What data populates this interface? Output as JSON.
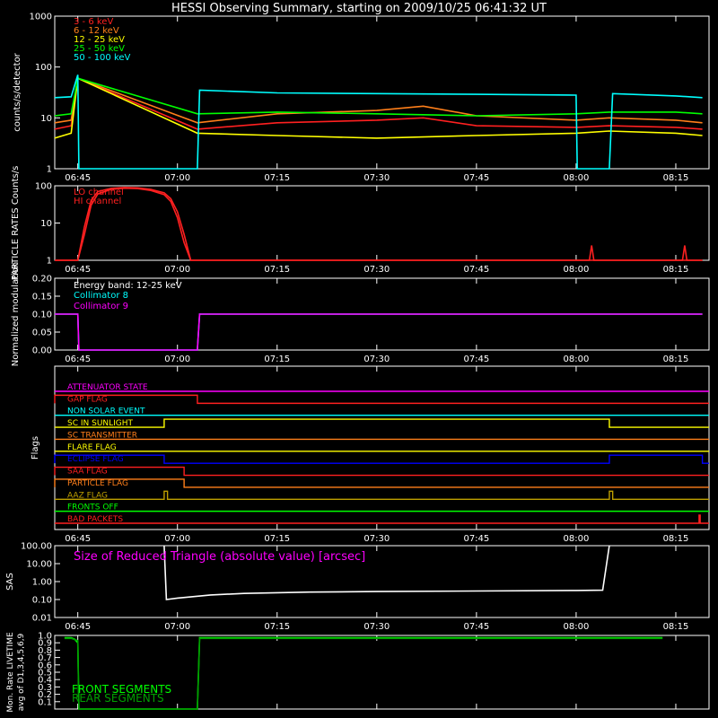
{
  "title": "HESSI Observing Summary, starting on 2009/10/25 06:41:32 UT",
  "time_ticks": [
    "06:45",
    "07:00",
    "07:15",
    "07:30",
    "07:45",
    "08:00",
    "08:15"
  ],
  "colors": {
    "background": "#000000",
    "axes": "#ffffff",
    "red": "#ff2020",
    "orange": "#ff7f1a",
    "yellow": "#ffff00",
    "green": "#00ff00",
    "cyan": "#00ffff",
    "magenta": "#ff00ff",
    "blue": "#0000ff",
    "olive": "#bfa000",
    "dark_green": "#00a000"
  },
  "chart_data": [
    {
      "type": "line",
      "panel": "count_rates",
      "ylabel": "counts/s/detector",
      "yscale": "log",
      "ylim": [
        1,
        1000
      ],
      "yticks": [
        "1",
        "10",
        "100",
        "1000"
      ],
      "legend_position": "top-left",
      "series": [
        {
          "name": "3 - 6 keV",
          "color": "#ff2020",
          "x": [
            "06:41:32",
            "06:44",
            "06:45",
            "07:03",
            "07:15",
            "07:30",
            "07:37",
            "07:45",
            "08:00",
            "08:05",
            "08:15",
            "08:19"
          ],
          "y": [
            6,
            7,
            60,
            6,
            8,
            9,
            10,
            7,
            6.5,
            7,
            6.5,
            6
          ]
        },
        {
          "name": "6 - 12 keV",
          "color": "#ff7f1a",
          "x": [
            "06:41:32",
            "06:44",
            "06:45",
            "07:03",
            "07:15",
            "07:30",
            "07:37",
            "07:45",
            "08:00",
            "08:05",
            "08:15",
            "08:19"
          ],
          "y": [
            8,
            9,
            60,
            8,
            12,
            14,
            17,
            11,
            9,
            10,
            9,
            8
          ]
        },
        {
          "name": "12 - 25 keV",
          "color": "#ffff00",
          "x": [
            "06:41:32",
            "06:44",
            "06:45",
            "07:03",
            "07:15",
            "07:30",
            "07:45",
            "08:00",
            "08:05",
            "08:15",
            "08:19"
          ],
          "y": [
            4,
            5,
            60,
            5,
            4.5,
            4,
            4.5,
            5,
            5.5,
            5,
            4.5
          ]
        },
        {
          "name": "25 - 50 keV",
          "color": "#00ff00",
          "x": [
            "06:41:32",
            "06:44",
            "06:45",
            "07:03",
            "07:15",
            "07:30",
            "07:45",
            "08:00",
            "08:05",
            "08:15",
            "08:19"
          ],
          "y": [
            11,
            12,
            60,
            12,
            13,
            12,
            11,
            12,
            13,
            13,
            12
          ]
        },
        {
          "name": "50 - 100 keV",
          "color": "#00ffff",
          "x": [
            "06:41:32",
            "06:44",
            "06:45",
            "06:45:10",
            "07:03",
            "07:03:20",
            "07:15",
            "07:30",
            "07:45",
            "08:00",
            "08:00:10",
            "08:05",
            "08:05:30",
            "08:15",
            "08:19"
          ],
          "y": [
            25,
            26,
            70,
            1,
            1,
            35,
            31,
            30,
            29,
            28,
            1,
            1,
            30,
            27,
            25
          ]
        }
      ]
    },
    {
      "type": "line",
      "panel": "particle_rates",
      "ylabel": "PARTICLE RATES Counts/s",
      "yscale": "log",
      "ylim": [
        1,
        100
      ],
      "yticks": [
        "1",
        "10",
        "100"
      ],
      "legend_position": "top-left",
      "series": [
        {
          "name": "LO channel",
          "color": "#ff2020",
          "x": [
            "06:41:32",
            "06:45",
            "06:46",
            "06:47",
            "06:48",
            "06:50",
            "06:52",
            "06:54",
            "06:56",
            "06:58",
            "06:59",
            "07:00",
            "07:01",
            "07:02",
            "07:05",
            "08:02",
            "08:02:20",
            "08:02:40",
            "08:16",
            "08:16:20",
            "08:16:40",
            "08:19"
          ],
          "y": [
            1,
            1,
            8,
            40,
            70,
            85,
            90,
            88,
            80,
            65,
            45,
            20,
            5,
            1,
            1,
            1,
            2.5,
            1,
            1,
            2.5,
            1,
            1
          ]
        },
        {
          "name": "HI channel",
          "color": "#ff2020",
          "x": [
            "06:41:32",
            "06:45",
            "06:46",
            "06:47",
            "06:48",
            "06:50",
            "06:52",
            "06:54",
            "06:56",
            "06:58",
            "06:59",
            "07:00",
            "07:01",
            "07:02",
            "07:05",
            "08:19"
          ],
          "y": [
            1,
            1,
            5,
            30,
            60,
            80,
            86,
            84,
            75,
            58,
            38,
            14,
            3,
            1,
            1,
            1
          ]
        }
      ]
    },
    {
      "type": "line",
      "panel": "modulation",
      "ylabel": "Normalized modulation",
      "ylim": [
        0,
        0.2
      ],
      "yticks": [
        "0.00",
        "0.05",
        "0.10",
        "0.15",
        "0.20"
      ],
      "legend_position": "top-left",
      "annotation": "Energy band: 12-25 keV",
      "series": [
        {
          "name": "Collimator 8",
          "color": "#00ffff",
          "x": [
            "06:41:32",
            "06:45",
            "06:45:10",
            "07:03",
            "07:03:20",
            "08:19"
          ],
          "y": [
            0.1,
            0.1,
            0,
            0,
            0.1,
            0.1
          ]
        },
        {
          "name": "Collimator 9",
          "color": "#ff00ff",
          "x": [
            "06:41:32",
            "06:45",
            "06:45:10",
            "07:03",
            "07:03:20",
            "08:19"
          ],
          "y": [
            0.1,
            0.1,
            0,
            0,
            0.1,
            0.1
          ]
        }
      ]
    },
    {
      "type": "line",
      "panel": "flags",
      "ylabel": "Flags",
      "flags": [
        {
          "name": "ATTENUATOR STATE",
          "color": "#ff00ff",
          "on": []
        },
        {
          "name": "GAP FLAG",
          "color": "#ff2020",
          "on": [
            [
              "06:41:32",
              "07:03"
            ]
          ]
        },
        {
          "name": "NON SOLAR EVENT",
          "color": "#00ffff",
          "on": []
        },
        {
          "name": "SC IN SUNLIGHT",
          "color": "#ffff00",
          "on": [
            [
              "06:58",
              "08:05"
            ]
          ]
        },
        {
          "name": "SC TRANSMITTER",
          "color": "#ff7f1a",
          "on": []
        },
        {
          "name": "FLARE FLAG",
          "color": "#ffff00",
          "on": []
        },
        {
          "name": "ECLIPSE FLAG",
          "color": "#0000ff",
          "on": [
            [
              "06:41:32",
              "06:58"
            ],
            [
              "08:05",
              "08:19"
            ]
          ]
        },
        {
          "name": "SAA FLAG",
          "color": "#ff2020",
          "on": [
            [
              "06:41:32",
              "07:01"
            ]
          ]
        },
        {
          "name": "PARTICLE FLAG",
          "color": "#ff7f1a",
          "on": [
            [
              "06:41:32",
              "07:01"
            ]
          ]
        },
        {
          "name": "AAZ FLAG",
          "color": "#bfa000",
          "on": [
            [
              "06:58",
              "06:58:30"
            ],
            [
              "08:05",
              "08:05:30"
            ]
          ]
        },
        {
          "name": "FRONTS OFF",
          "color": "#00ff00",
          "on": []
        },
        {
          "name": "BAD PACKETS",
          "color": "#ff2020",
          "on": [
            [
              "08:18:30",
              "08:18:40"
            ]
          ]
        }
      ]
    },
    {
      "type": "line",
      "panel": "sas",
      "ylabel": "SAS",
      "yscale": "log",
      "ylim": [
        0.01,
        100
      ],
      "yticks": [
        "0.01",
        "0.10",
        "1.00",
        "10.00",
        "100.00"
      ],
      "annotation": "Size of Reduced Triangle (absolute value) [arcsec]",
      "series": [
        {
          "color": "#ffffff",
          "x": [
            "06:58",
            "06:58:20",
            "07:00",
            "07:05",
            "07:10",
            "07:20",
            "07:30",
            "07:45",
            "08:00",
            "08:04",
            "08:05"
          ],
          "y": [
            100,
            0.1,
            0.12,
            0.18,
            0.22,
            0.26,
            0.28,
            0.3,
            0.32,
            0.33,
            100
          ]
        }
      ]
    },
    {
      "type": "line",
      "panel": "livetime",
      "ylabel": "Mon. Rate LIVETIME avg of D1,3,4,5,6,9",
      "ylim": [
        0,
        1
      ],
      "yticks": [
        "0.1",
        "0.2",
        "0.3",
        "0.4",
        "0.5",
        "0.6",
        "0.7",
        "0.8",
        "0.9",
        "1.0"
      ],
      "legend_position": "bottom-left",
      "series": [
        {
          "name": "FRONT SEGMENTS",
          "color": "#00ff00",
          "x": [
            "06:43",
            "06:44",
            "06:44:30",
            "06:45",
            "06:45:10",
            "07:03",
            "07:03:20",
            "08:13"
          ],
          "y": [
            0.97,
            0.97,
            0.95,
            0.9,
            0,
            0,
            0.97,
            0.97
          ]
        },
        {
          "name": "REAR SEGMENTS",
          "color": "#00a000",
          "x": [
            "06:43",
            "06:44",
            "06:45",
            "06:45:10",
            "07:03",
            "07:03:20",
            "08:13"
          ],
          "y": [
            0.96,
            0.96,
            0.93,
            0,
            0,
            0.96,
            0.96
          ]
        }
      ]
    }
  ]
}
